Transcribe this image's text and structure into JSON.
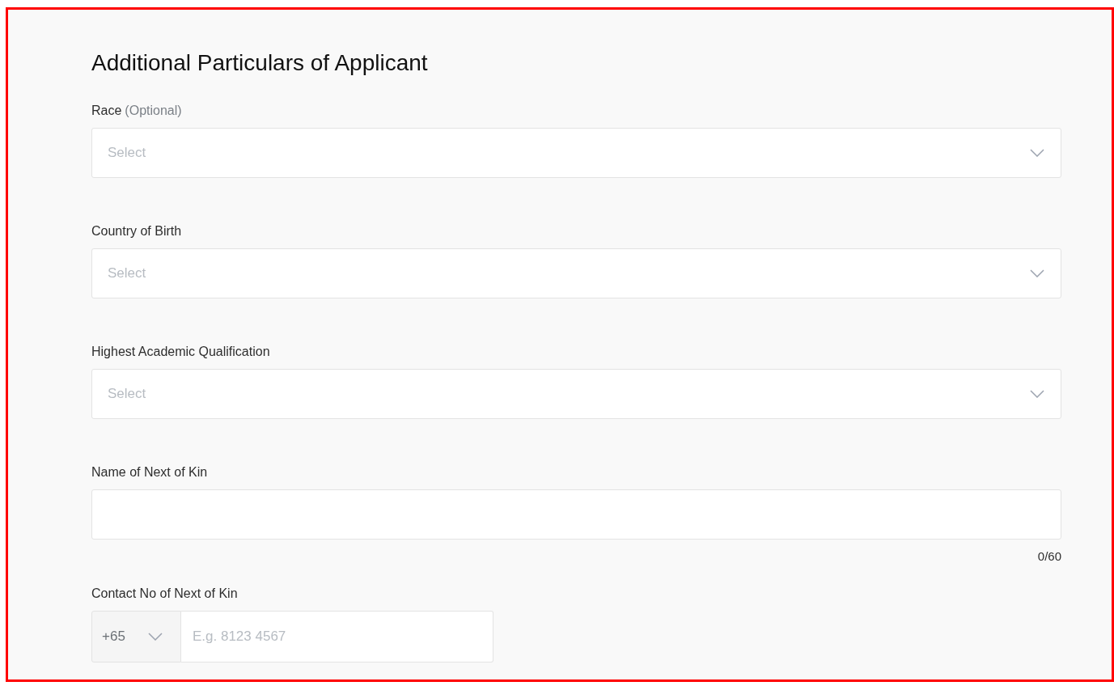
{
  "title": "Additional Particulars of Applicant",
  "fields": [
    {
      "kind": "select",
      "label": "Race",
      "optional": "(Optional)",
      "placeholder": "Select"
    },
    {
      "kind": "select",
      "label": "Country of Birth",
      "placeholder": "Select"
    },
    {
      "kind": "select",
      "label": "Highest Academic Qualification",
      "placeholder": "Select"
    },
    {
      "kind": "text",
      "label": "Name of Next of Kin",
      "counter": "0/60"
    },
    {
      "kind": "phone",
      "label": "Contact No of Next of Kin",
      "code": "+65",
      "placeholder": "E.g. 8123 4567"
    }
  ]
}
